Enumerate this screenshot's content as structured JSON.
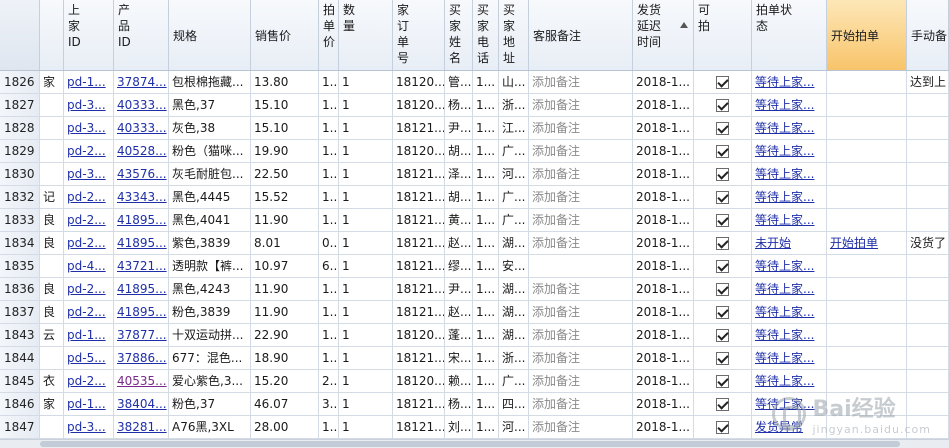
{
  "columns": [
    {
      "key": "row",
      "label": "",
      "cls": "corner"
    },
    {
      "key": "c0",
      "label": ""
    },
    {
      "key": "c1",
      "label": "上\n家\nID"
    },
    {
      "key": "c2",
      "label": "产\n品\nID"
    },
    {
      "key": "c3",
      "label": "规格",
      "vcenter": true
    },
    {
      "key": "c4",
      "label": "销售价",
      "vcenter": true
    },
    {
      "key": "c5",
      "label": "拍\n单\n价"
    },
    {
      "key": "c6",
      "label": "数\n量"
    },
    {
      "key": "c7",
      "label": "家\n订\n单\n号"
    },
    {
      "key": "c8",
      "label": "买\n家\n姓\n名"
    },
    {
      "key": "c9",
      "label": "买\n家\n电\n话"
    },
    {
      "key": "c10",
      "label": "买\n家\n地\n址"
    },
    {
      "key": "c11",
      "label": "客服备注",
      "vcenter": true
    },
    {
      "key": "c12",
      "label": "发货\n延迟\n时间",
      "sorted": true
    },
    {
      "key": "c13",
      "label": "可\n拍"
    },
    {
      "key": "c14",
      "label": "拍单状\n态"
    },
    {
      "key": "c15",
      "label": "开始拍单",
      "vcenter": true,
      "active": true
    },
    {
      "key": "c16",
      "label": "手动备",
      "vcenter": true
    }
  ],
  "rows": [
    {
      "row": "1826",
      "c0": "家",
      "c1": "pd-1...",
      "c2": "37874...",
      "c3": "包根棉拖藏...",
      "c4": "13.80",
      "c5": "1...",
      "c6": "1",
      "c7": "18120...",
      "c8": "管...",
      "c9": "1...",
      "c10": "山...",
      "c11": "添加备注",
      "c12": "2018-1...",
      "c13": true,
      "c14": "等待上家...",
      "c15": "",
      "c16": "达到上"
    },
    {
      "row": "1827",
      "c0": "",
      "c1": "pd-3...",
      "c2": "40333...",
      "c3": "黑色,37",
      "c4": "15.10",
      "c5": "1...",
      "c6": "1",
      "c7": "18120...",
      "c8": "杨...",
      "c9": "1...",
      "c10": "浙...",
      "c11": "添加备注",
      "c12": "2018-1...",
      "c13": true,
      "c14": "等待上家...",
      "c15": "",
      "c16": ""
    },
    {
      "row": "1828",
      "c0": "",
      "c1": "pd-3...",
      "c2": "40333...",
      "c3": "灰色,38",
      "c4": "15.10",
      "c5": "1...",
      "c6": "1",
      "c7": "18121...",
      "c8": "尹...",
      "c9": "1...",
      "c10": "江...",
      "c11": "添加备注",
      "c12": "2018-1...",
      "c13": true,
      "c14": "等待上家...",
      "c15": "",
      "c16": ""
    },
    {
      "row": "1829",
      "c0": "",
      "c1": "pd-2...",
      "c2": "40528...",
      "c3": "粉色（猫咪...",
      "c4": "19.90",
      "c5": "1...",
      "c6": "1",
      "c7": "18120...",
      "c8": "胡...",
      "c9": "1...",
      "c10": "广...",
      "c11": "添加备注",
      "c12": "2018-1...",
      "c13": true,
      "c14": "等待上家...",
      "c15": "",
      "c16": ""
    },
    {
      "row": "1830",
      "c0": "",
      "c1": "pd-3...",
      "c2": "43576...",
      "c3": "灰毛耐脏包...",
      "c4": "22.50",
      "c5": "1...",
      "c6": "1",
      "c7": "18121...",
      "c8": "泽...",
      "c9": "1...",
      "c10": "河...",
      "c11": "添加备注",
      "c12": "2018-1...",
      "c13": true,
      "c14": "等待上家...",
      "c15": "",
      "c16": ""
    },
    {
      "row": "1832",
      "c0": "记",
      "c1": "pd-2...",
      "c2": "43343...",
      "c3": "黑色,4445",
      "c4": "15.52",
      "c5": "1...",
      "c6": "1",
      "c7": "18121...",
      "c8": "胡...",
      "c9": "1...",
      "c10": "广...",
      "c11": "添加备注",
      "c12": "2018-1...",
      "c13": true,
      "c14": "等待上家...",
      "c15": "",
      "c16": ""
    },
    {
      "row": "1833",
      "c0": "良",
      "c1": "pd-2...",
      "c2": "41895...",
      "c3": "黑色,4041",
      "c4": "11.90",
      "c5": "1...",
      "c6": "1",
      "c7": "18121...",
      "c8": "黄...",
      "c9": "1...",
      "c10": "广...",
      "c11": "添加备注",
      "c12": "2018-1...",
      "c13": true,
      "c14": "等待上家...",
      "c15": "",
      "c16": ""
    },
    {
      "row": "1834",
      "c0": "良",
      "c1": "pd-2...",
      "c2": "41895...",
      "c3": "紫色,3839",
      "c4": "8.01",
      "c5": "0...",
      "c6": "1",
      "c7": "18121...",
      "c8": "赵...",
      "c9": "1...",
      "c10": "湖...",
      "c11": "添加备注",
      "c12": "2018-1...",
      "c13": true,
      "c14": "未开始",
      "c15": "开始拍单",
      "c16": "没货了"
    },
    {
      "row": "1835",
      "c0": "",
      "c1": "pd-4...",
      "c2": "43721...",
      "c3": "透明款【裤...",
      "c4": "10.97",
      "c5": "6...",
      "c6": "1",
      "c7": "18121...",
      "c8": "缪...",
      "c9": "1...",
      "c10": "安...",
      "c11": "",
      "c12": "2018-1...",
      "c13": true,
      "c14": "等待上家...",
      "c15": "",
      "c16": ""
    },
    {
      "row": "1836",
      "c0": "良",
      "c1": "pd-2...",
      "c2": "41895...",
      "c3": "黑色,4243",
      "c4": "11.90",
      "c5": "1...",
      "c6": "1",
      "c7": "18121...",
      "c8": "尹...",
      "c9": "1...",
      "c10": "湖...",
      "c11": "添加备注",
      "c12": "2018-1...",
      "c13": true,
      "c14": "等待上家...",
      "c15": "",
      "c16": ""
    },
    {
      "row": "1837",
      "c0": "良",
      "c1": "pd-2...",
      "c2": "41895...",
      "c3": "粉色,3839",
      "c4": "11.90",
      "c5": "1...",
      "c6": "1",
      "c7": "18121...",
      "c8": "赵...",
      "c9": "1...",
      "c10": "湖...",
      "c11": "添加备注",
      "c12": "2018-1...",
      "c13": true,
      "c14": "等待上家...",
      "c15": "",
      "c16": ""
    },
    {
      "row": "1843",
      "c0": "云",
      "c1": "pd-1...",
      "c2": "37877...",
      "c3": "十双运动拼...",
      "c4": "22.90",
      "c5": "1...",
      "c6": "1",
      "c7": "18120...",
      "c8": "蓬...",
      "c9": "1...",
      "c10": "湖...",
      "c11": "添加备注",
      "c12": "2018-1...",
      "c13": true,
      "c14": "等待上家...",
      "c15": "",
      "c16": ""
    },
    {
      "row": "1844",
      "c0": "",
      "c1": "pd-5...",
      "c2": "37886...",
      "c3": "677：混色...",
      "c4": "18.90",
      "c5": "1...",
      "c6": "1",
      "c7": "18121...",
      "c8": "宋...",
      "c9": "1...",
      "c10": "浙...",
      "c11": "添加备注",
      "c12": "2018-1...",
      "c13": true,
      "c14": "等待上家...",
      "c15": "",
      "c16": ""
    },
    {
      "row": "1845",
      "c0": "衣",
      "c1": "pd-2...",
      "c2": "40535...",
      "c3": "爱心紫色,3...",
      "c4": "15.20",
      "c5": "2...",
      "c6": "1",
      "c7": "18120...",
      "c8": "赖...",
      "c9": "1...",
      "c10": "广...",
      "c11": "添加备注",
      "c12": "2018-1...",
      "c13": true,
      "c14": "等待上家...",
      "c15": "",
      "c16": "",
      "c2visited": true
    },
    {
      "row": "1846",
      "c0": "家",
      "c1": "pd-1...",
      "c2": "38404...",
      "c3": "粉色,37",
      "c4": "46.07",
      "c5": "3...",
      "c6": "1",
      "c7": "18121...",
      "c8": "杨...",
      "c9": "1...",
      "c10": "四...",
      "c11": "添加备注",
      "c12": "2018-1...",
      "c13": true,
      "c14": "等待上家...",
      "c15": "",
      "c16": ""
    },
    {
      "row": "1847",
      "c0": "",
      "c1": "pd-3...",
      "c2": "38281...",
      "c3": "A76黑,3XL",
      "c4": "28.00",
      "c5": "1...",
      "c6": "1",
      "c7": "18121...",
      "c8": "刘...",
      "c9": "1...",
      "c10": "河...",
      "c11": "添加备注",
      "c12": "2018-1...",
      "c13": true,
      "c14": "发货异常",
      "c15": "",
      "c16": ""
    }
  ],
  "watermark": {
    "logo_text": "Bai",
    "text": "经验",
    "sub": "jingyan.baidu.com"
  }
}
